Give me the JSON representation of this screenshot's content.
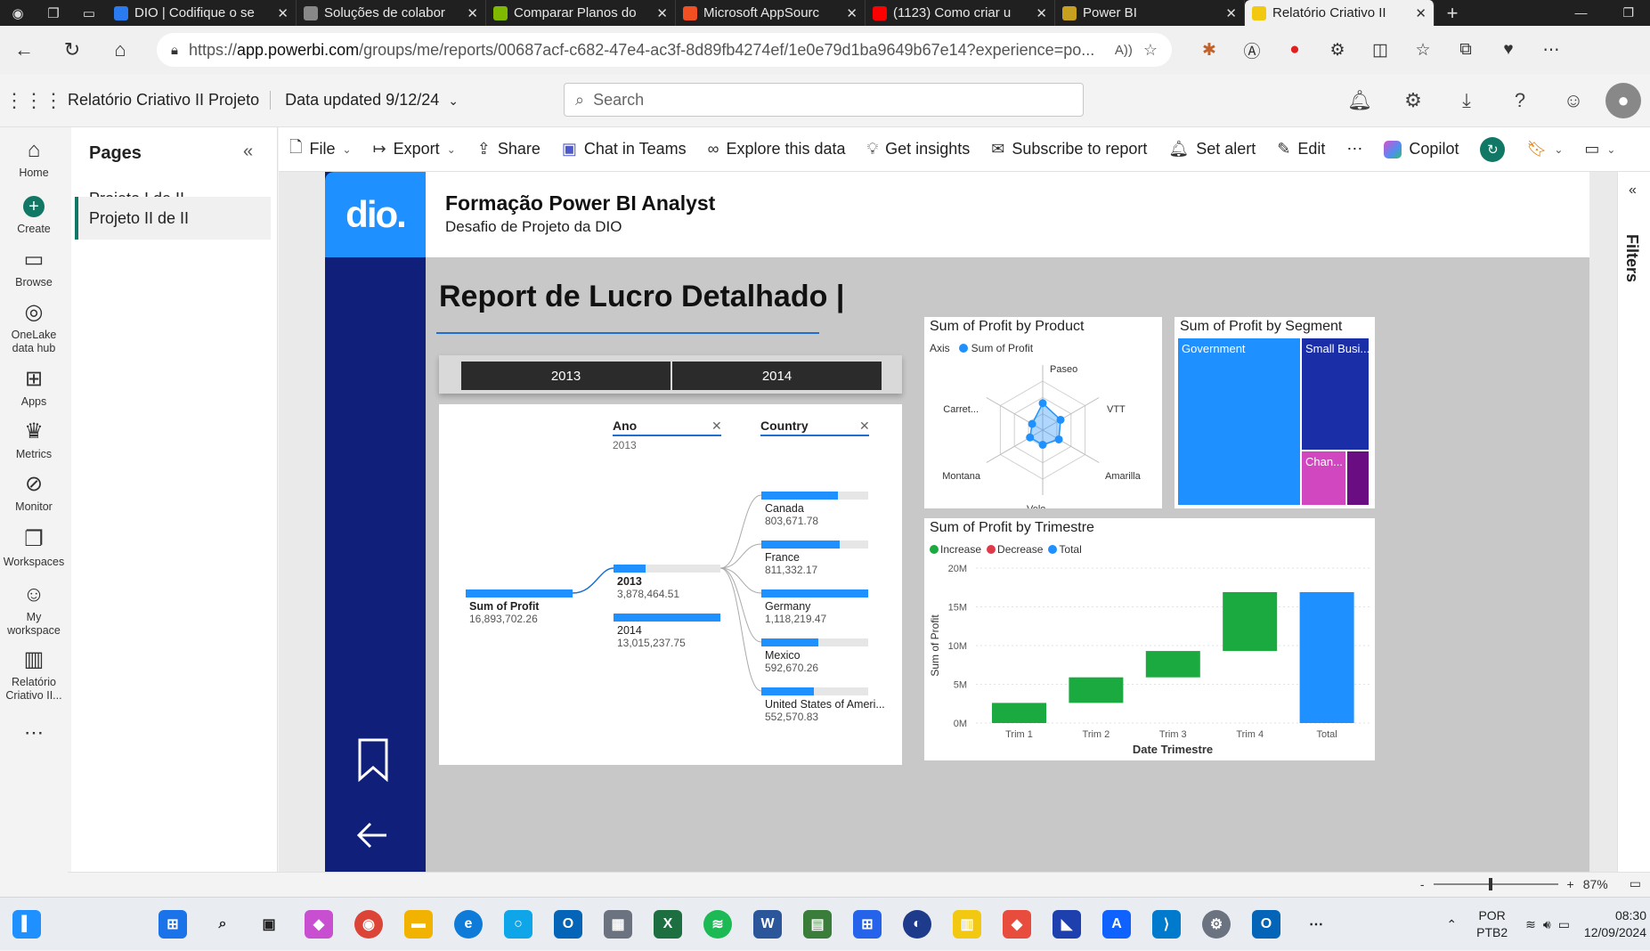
{
  "browser": {
    "tabs": [
      {
        "title": "DIO | Codifique o se",
        "color": "#2a7bf0"
      },
      {
        "title": "Soluções de colabor",
        "color": "#888888"
      },
      {
        "title": "Comparar Planos do",
        "color": "#7fba00"
      },
      {
        "title": "Microsoft AppSourc",
        "color": "#f25022"
      },
      {
        "title": "(1123) Como criar u",
        "color": "#ff0000"
      },
      {
        "title": "Power BI",
        "color": "#c8a020"
      },
      {
        "title": "Relatório Criativo II",
        "color": "#f2c811"
      }
    ],
    "url_domain": "app.powerbi.com",
    "url_prefix": "https://",
    "url_rest": "/groups/me/reports/00687acf-c682-47e4-ac3f-8d89fb4274ef/1e0e79d1ba9649b67e14?experience=po..."
  },
  "header": {
    "report_name": "Relatório Criativo II Projeto",
    "data_updated": "Data updated 9/12/24",
    "search_placeholder": "Search"
  },
  "leftnav": [
    {
      "label": "Home",
      "icon": "⌂"
    },
    {
      "label": "Create",
      "icon": "+"
    },
    {
      "label": "Browse",
      "icon": "▭"
    },
    {
      "label": "OneLake data hub",
      "icon": "◎"
    },
    {
      "label": "Apps",
      "icon": "⊞"
    },
    {
      "label": "Metrics",
      "icon": "♛"
    },
    {
      "label": "Monitor",
      "icon": "⊘"
    },
    {
      "label": "Workspaces",
      "icon": "❐"
    },
    {
      "label": "My workspace",
      "icon": "☺"
    },
    {
      "label": "Relatório Criativo II...",
      "icon": "▥"
    }
  ],
  "pages": {
    "title": "Pages",
    "items": [
      "Projeto I de II",
      "Projeto II de II"
    ]
  },
  "toolbar": {
    "file": "File",
    "export": "Export",
    "share": "Share",
    "chat": "Chat in Teams",
    "explore": "Explore this data",
    "insights": "Get insights",
    "subscribe": "Subscribe to report",
    "alert": "Set alert",
    "edit": "Edit",
    "copilot": "Copilot"
  },
  "filters_label": "Filters",
  "report": {
    "title": "Formação Power BI Analyst",
    "subtitle": "Desafio de Projeto da DIO",
    "logo_text": "dio.",
    "main_title": "Report de Lucro Detalhado |",
    "slicer": [
      "2013",
      "2014"
    ]
  },
  "decomp": {
    "col_ano": "Ano",
    "col_ano_sub": "2013",
    "col_country": "Country",
    "root_label": "Sum of Profit",
    "root_value": "16,893,702.26",
    "years": [
      {
        "label": "2013",
        "value": "3,878,464.51",
        "fill": 0.3
      },
      {
        "label": "2014",
        "value": "13,015,237.75",
        "fill": 1.0
      }
    ],
    "countries": [
      {
        "label": "Canada",
        "value": "803,671.78",
        "fill": 0.72
      },
      {
        "label": "France",
        "value": "811,332.17",
        "fill": 0.73
      },
      {
        "label": "Germany",
        "value": "1,118,219.47",
        "fill": 1.0
      },
      {
        "label": "Mexico",
        "value": "592,670.26",
        "fill": 0.53
      },
      {
        "label": "United States of Ameri...",
        "value": "552,570.83",
        "fill": 0.49
      }
    ]
  },
  "radar": {
    "title": "Sum of Profit by Product",
    "legend_axis": "Axis",
    "legend_series": "Sum of Profit",
    "axes": [
      "Paseo",
      "VTT",
      "Amarilla",
      "Velo",
      "Montana",
      "Carret..."
    ],
    "values": [
      0.55,
      0.42,
      0.38,
      0.3,
      0.3,
      0.25
    ]
  },
  "treemap": {
    "title": "Sum of Profit by Segment",
    "tiles": [
      {
        "label": "Government",
        "color": "#1e90ff"
      },
      {
        "label": "Small Busi...",
        "color": "#1a2ea8"
      },
      {
        "label": "Chan...",
        "color": "#d147c0"
      },
      {
        "label": "",
        "color": "#6a0d83"
      }
    ]
  },
  "chart_data": {
    "type": "bar",
    "title": "Sum of Profit by Trimestre",
    "xlabel": "Date Trimestre",
    "ylabel": "Sum of Profit",
    "categories": [
      "Trim 1",
      "Trim 2",
      "Trim 3",
      "Trim 4",
      "Total"
    ],
    "waterfall": [
      {
        "start": 0,
        "end": 2.6,
        "kind": "increase"
      },
      {
        "start": 2.6,
        "end": 5.9,
        "kind": "increase"
      },
      {
        "start": 5.9,
        "end": 9.3,
        "kind": "increase"
      },
      {
        "start": 9.3,
        "end": 16.9,
        "kind": "increase"
      },
      {
        "start": 0,
        "end": 16.9,
        "kind": "total"
      }
    ],
    "legend": [
      {
        "name": "Increase",
        "color": "#1aaa3f"
      },
      {
        "name": "Decrease",
        "color": "#e0394a"
      },
      {
        "name": "Total",
        "color": "#1e90ff"
      }
    ],
    "y_ticks": [
      "0M",
      "5M",
      "10M",
      "15M",
      "20M"
    ],
    "ylim": [
      0,
      20
    ]
  },
  "status": {
    "zoom": "87%"
  },
  "taskbar": {
    "lang1": "POR",
    "lang2": "PTB2",
    "time": "08:30",
    "date": "12/09/2024"
  }
}
